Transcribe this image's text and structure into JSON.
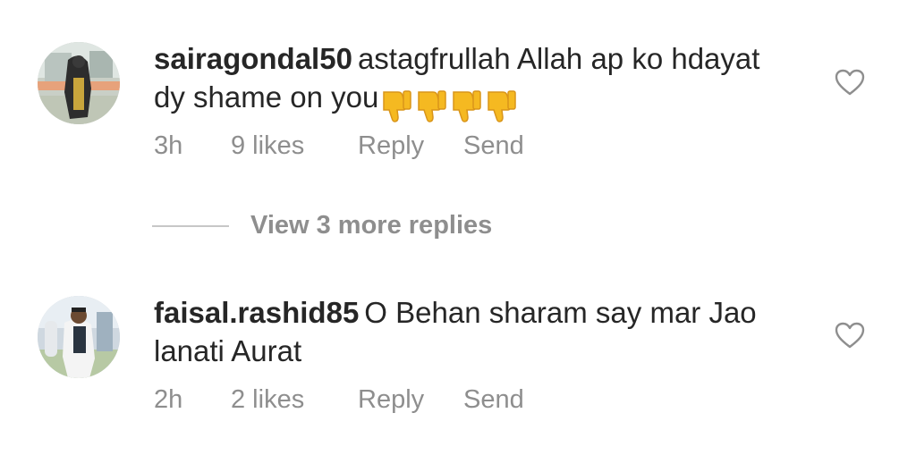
{
  "comments": [
    {
      "username": "sairagondal50",
      "text": "astagfrullah Allah ap ko hdayat dy shame on you",
      "emoji": [
        "thumbs-down",
        "thumbs-down",
        "thumbs-down",
        "thumbs-down"
      ],
      "time": "3h",
      "likes": "9 likes",
      "reply_label": "Reply",
      "send_label": "Send"
    },
    {
      "username": "faisal.rashid85",
      "text": "O Behan sharam say mar Jao lanati Aurat",
      "time": "2h",
      "likes": "2 likes",
      "reply_label": "Reply",
      "send_label": "Send"
    }
  ],
  "view_replies": {
    "label": "View 3 more replies"
  },
  "colors": {
    "text": "#262626",
    "meta": "#8e8e8e",
    "divider": "#c7c7c7",
    "emoji": "#f5b921"
  },
  "icons": {
    "like": "heart-outline-icon",
    "emoji": "thumbs-down-emoji"
  }
}
